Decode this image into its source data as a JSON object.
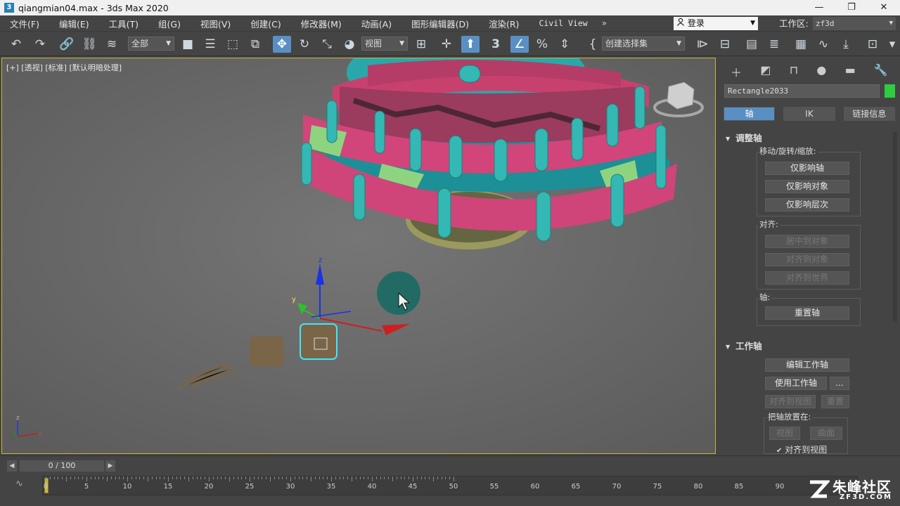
{
  "title": {
    "app_title": "qiangmian04.max - 3ds Max 2020",
    "app_icon": "3"
  },
  "window_buttons": {
    "minimize": "—",
    "maximize": "❐",
    "close": "✕"
  },
  "menu": [
    "文件(F)",
    "编辑(E)",
    "工具(T)",
    "组(G)",
    "视图(V)",
    "创建(C)",
    "修改器(M)",
    "动画(A)",
    "图形编辑器(D)",
    "渲染(R)",
    "Civil View"
  ],
  "menu_more": "»",
  "login": {
    "label": "登录",
    "icon": "user-icon"
  },
  "workspace": {
    "label": "工作区:",
    "value": "zf3d"
  },
  "toolbar": {
    "selection_filter": "全部",
    "ref_coord": "视图",
    "named_selection": "创建选择集",
    "snap_toggle": "3"
  },
  "viewport": {
    "label": "[+] [透视] [标准] [默认明暗处理]",
    "axis_labels": {
      "x": "x",
      "y": "y",
      "z": "z"
    }
  },
  "command_panel": {
    "tab_icons": [
      "create-icon",
      "modify-icon",
      "hierarchy-icon",
      "motion-icon",
      "display-icon",
      "utilities-icon"
    ],
    "object_name": "Rectangle2033",
    "object_color": "#2ecc3e",
    "subtabs": [
      "轴",
      "IK",
      "链接信息"
    ],
    "adjust_pivot": {
      "heading": "调整轴",
      "move_group_label": "移动/旋转/缩放:",
      "affect_pivot": "仅影响轴",
      "affect_object": "仅影响对象",
      "affect_hierarchy": "仅影响层次",
      "align_label": "对齐:",
      "center_to_object": "居中到对象",
      "align_to_object": "对齐到对象",
      "align_to_world": "对齐到世界",
      "pivot_label": "轴:",
      "reset_pivot": "重置轴"
    },
    "working_pivot": {
      "heading": "工作轴",
      "edit_working_pivot": "编辑工作轴",
      "use_working_pivot": "使用工作轴",
      "more": "...",
      "align_to_view": "对齐到视图",
      "reset": "重置",
      "place_pivot_label": "把轴放置在:",
      "view": "视图",
      "surface": "曲面",
      "align_to_view_check": "对齐到视图"
    }
  },
  "timeline": {
    "frame_display": "0 / 100",
    "tick_labels": [
      "0",
      "5",
      "10",
      "15",
      "20",
      "25",
      "30",
      "35",
      "40",
      "45",
      "50",
      "55",
      "60",
      "65",
      "70",
      "75",
      "80",
      "85",
      "90"
    ]
  },
  "watermark": {
    "big": "朱峰社区",
    "small": "ZF3D.COM"
  },
  "colors": {
    "accent": "#5a8fc4",
    "viewport_border": "#c8b43c",
    "pink": "#c8416e",
    "teal": "#30b4b0"
  }
}
